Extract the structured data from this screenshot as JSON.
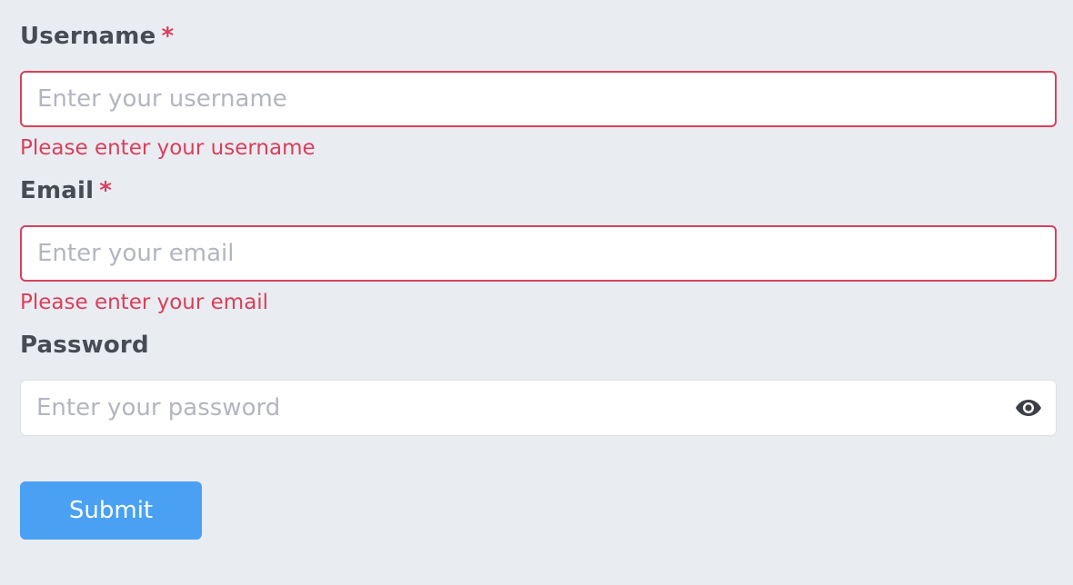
{
  "form": {
    "username": {
      "label": "Username",
      "required_mark": "*",
      "placeholder": "Enter your username",
      "value": "",
      "error": "Please enter your username"
    },
    "email": {
      "label": "Email",
      "required_mark": "*",
      "placeholder": "Enter your email",
      "value": "",
      "error": "Please enter your email"
    },
    "password": {
      "label": "Password",
      "placeholder": "Enter your password",
      "value": "",
      "toggle_icon": "eye-icon"
    },
    "submit_label": "Submit"
  },
  "colors": {
    "background": "#e9ecf1",
    "error": "#d8405c",
    "label": "#474b53",
    "placeholder": "#b3b6bf",
    "primary_button": "#4aa1f3"
  }
}
